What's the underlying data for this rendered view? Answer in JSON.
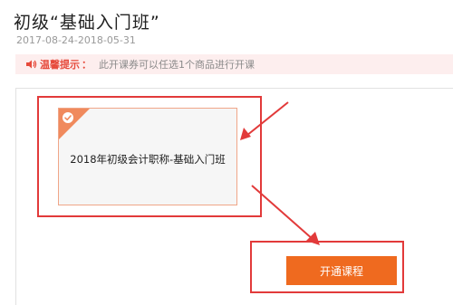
{
  "page": {
    "title": "初级“基础入门班”",
    "date_range": "2017-08-24-2018-05-31"
  },
  "tip": {
    "icon": "sound-icon",
    "label": "温馨提示",
    "colon": "：",
    "text": "此开课券可以任选1个商品进行开课"
  },
  "course_card": {
    "name": "2018年初级会计职称-基础入门班",
    "selected": true,
    "check_icon": "check-icon"
  },
  "actions": {
    "open_course_label": "开通课程"
  },
  "colors": {
    "accent": "#ef6a1f",
    "annotation_red": "#e23a3a",
    "tip_bg": "#fdeeee",
    "tip_label": "#e64a3b",
    "card_corner": "#f08a5d"
  }
}
